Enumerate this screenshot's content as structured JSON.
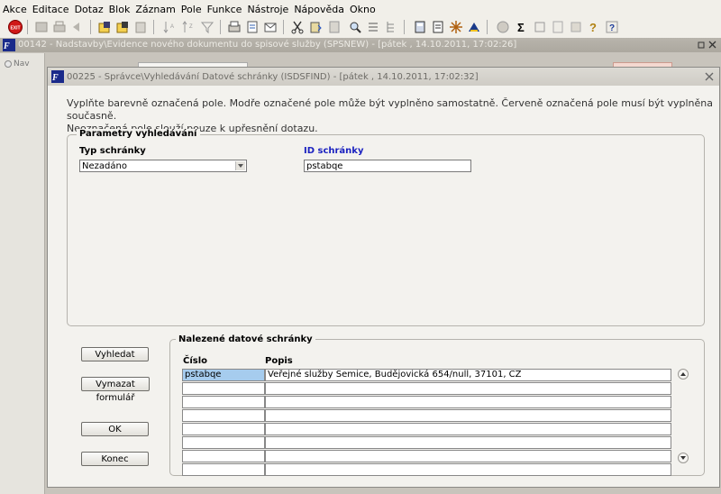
{
  "menu": [
    "Akce",
    "Editace",
    "Dotaz",
    "Blok",
    "Záznam",
    "Pole",
    "Funkce",
    "Nástroje",
    "Nápověda",
    "Okno"
  ],
  "toolbar": {
    "exit_label": "EXIT",
    "icons": [
      "exit-icon",
      "save-icon",
      "print-icon",
      "back-icon",
      "new-record-icon",
      "delete-record-icon",
      "sort-asc-icon",
      "sort-desc-icon",
      "filter-icon",
      "print-preview-icon",
      "print-setup-icon",
      "mail-icon",
      "cut-icon",
      "paste-icon",
      "find-icon",
      "zoom-icon",
      "list-icon",
      "tree-icon",
      "calculator-icon",
      "document-icon",
      "settings-icon",
      "warning-icon",
      "export-icon",
      "sum-icon",
      "text-icon",
      "page-icon",
      "wizard-icon",
      "help-icon"
    ]
  },
  "background_window": {
    "title": "00142 - Nadstavby\\Evidence nového dokumentu do spisové služby (SPSNEW) - [pátek , 14.10.2011, 17:02:26]",
    "nav_label": "Nav"
  },
  "dialog": {
    "title": "00225 - Správce\\Vyhledávání Datové schránky (ISDSFIND) - [pátek , 14.10.2011, 17:02:32]",
    "instruction_line1": "Vyplňte barevně označená pole. Modře označené pole může být vyplněno samostatně. Červeně označená pole musí být vyplněna současně.",
    "instruction_line2": "Neoznačená pole slouží pouze k upřesnění dotazu.",
    "params_group_label": "Parametry vyhledávání",
    "type_label": "Typ schránky",
    "type_value": "Nezadáno",
    "id_label": "ID schránky",
    "id_value": "pstabqe",
    "results_group_label": "Nalezené datové schránky",
    "col_number": "Číslo",
    "col_description": "Popis",
    "rows": [
      {
        "number": "pstabqe",
        "description": "Veřejné služby Semice, Budějovická 654/null, 37101, CZ"
      },
      {
        "number": "",
        "description": ""
      },
      {
        "number": "",
        "description": ""
      },
      {
        "number": "",
        "description": ""
      },
      {
        "number": "",
        "description": ""
      },
      {
        "number": "",
        "description": ""
      },
      {
        "number": "",
        "description": ""
      },
      {
        "number": "",
        "description": ""
      }
    ],
    "buttons": {
      "search": "Vyhledat",
      "clear": "Vymazat formulář",
      "ok": "OK",
      "end": "Konec"
    }
  }
}
